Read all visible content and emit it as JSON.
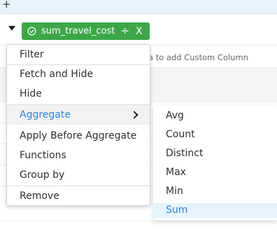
{
  "toolbar": {
    "add_icon": "+"
  },
  "column_chip": {
    "label": "sum_travel_cost",
    "status_icon": "check-circle-icon",
    "split_icon": "÷",
    "close_icon": "X",
    "color": "#3da748"
  },
  "hint_text": "a to add Custom Column",
  "context_menu": {
    "items": [
      {
        "label": "Filter"
      },
      {
        "label": "Fetch and Hide"
      },
      {
        "label": "Hide"
      },
      {
        "label": "Aggregate"
      },
      {
        "label": "Apply Before Aggregate"
      },
      {
        "label": "Functions"
      },
      {
        "label": "Group by"
      },
      {
        "label": "Remove"
      }
    ],
    "active_item": "Aggregate",
    "accent_color": "#2e86de"
  },
  "aggregate_submenu": {
    "items": [
      {
        "label": "Avg"
      },
      {
        "label": "Count"
      },
      {
        "label": "Distinct"
      },
      {
        "label": "Max"
      },
      {
        "label": "Min"
      },
      {
        "label": "Sum"
      }
    ],
    "selected_item": "Sum"
  }
}
